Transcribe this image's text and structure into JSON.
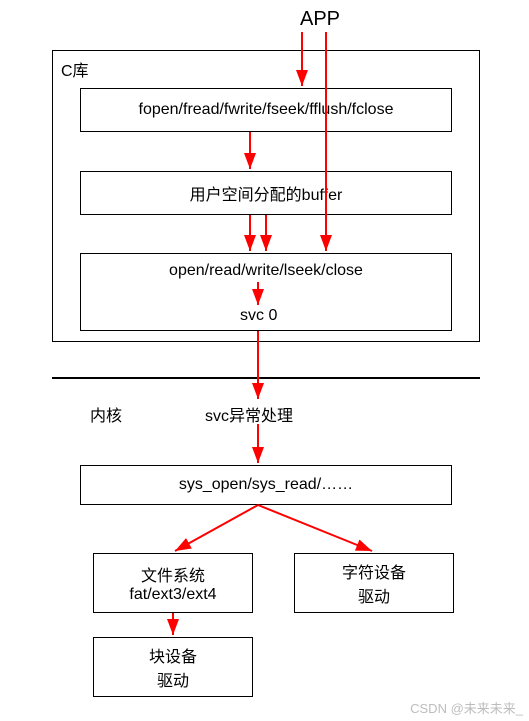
{
  "labels": {
    "app": "APP",
    "clib": "C库",
    "kernel": "内核",
    "svc_handler": "svc异常处理"
  },
  "boxes": {
    "clib_funcs": "fopen/fread/fwrite/fseek/fflush/fclose",
    "user_buffer": "用户空间分配的buffer",
    "syscalls": "open/read/write/lseek/close",
    "svc0": "svc 0",
    "sys_funcs": "sys_open/sys_read/……",
    "fs_title": "文件系统",
    "fs_list": "fat/ext3/ext4",
    "blk_title": "块设备",
    "blk_drv": "驱动",
    "char_title": "字符设备",
    "char_drv": "驱动"
  },
  "watermark": "CSDN @未来未来_"
}
